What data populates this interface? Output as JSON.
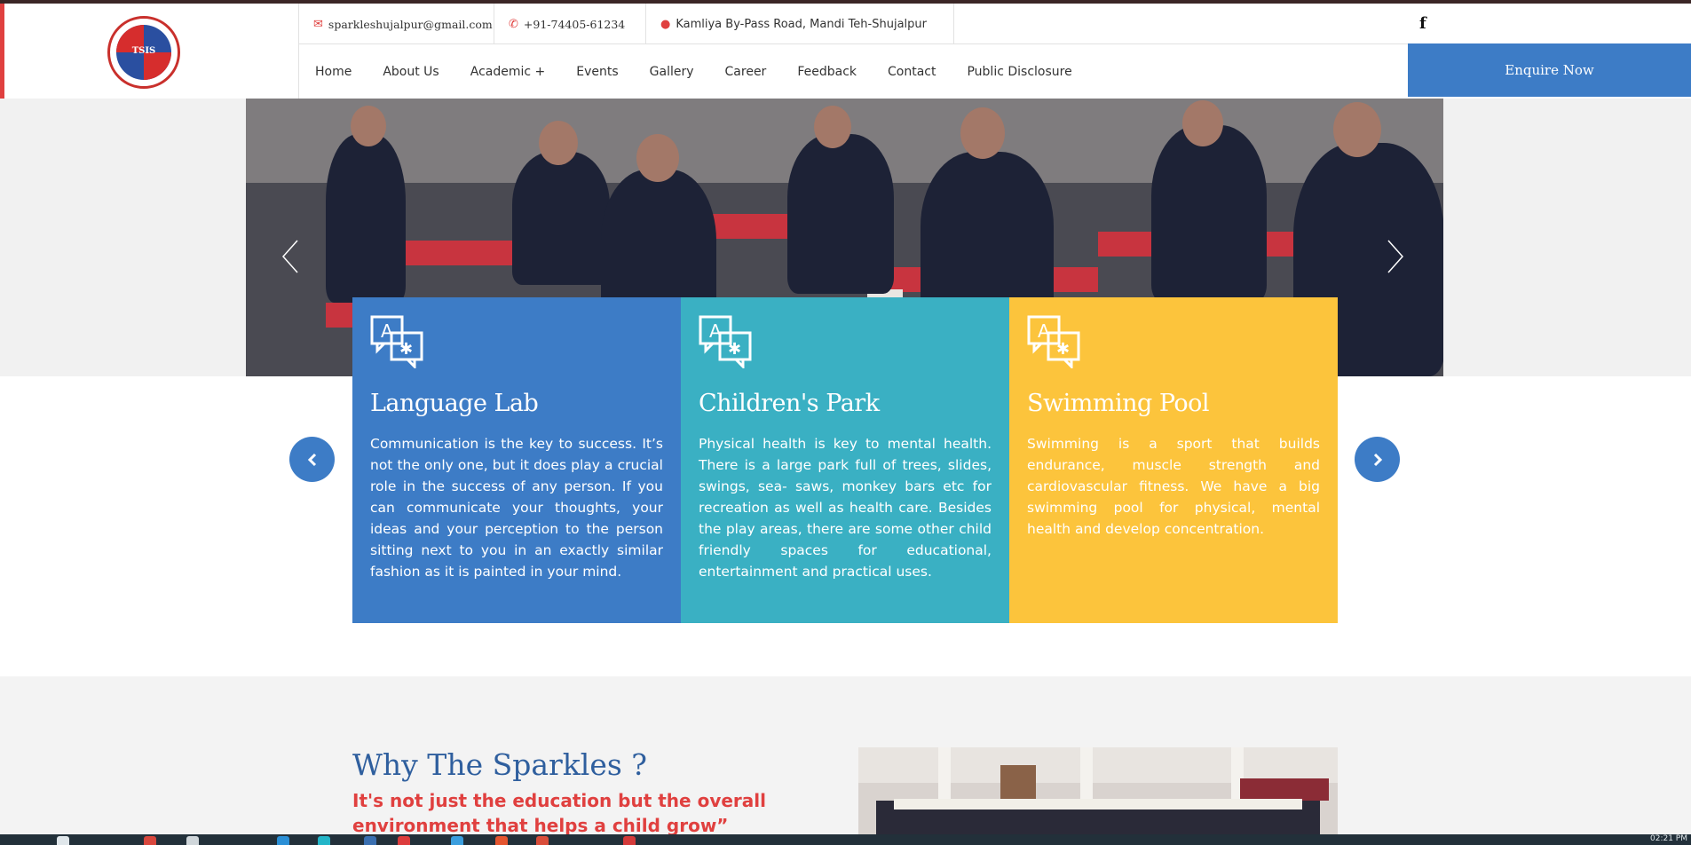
{
  "logo": {
    "text": "TSIS"
  },
  "contact": {
    "email": "sparkleshujalpur@gmail.com",
    "phone": "+91-74405-61234",
    "address": "Kamliya By-Pass Road, Mandi Teh-Shujalpur"
  },
  "social": {
    "facebook": "f"
  },
  "nav": {
    "items": [
      "Home",
      "About Us",
      "Academic +",
      "Events",
      "Gallery",
      "Career",
      "Feedback",
      "Contact",
      "Public Disclosure"
    ]
  },
  "cta": {
    "enquire": "Enquire Now"
  },
  "cards": [
    {
      "title": "Language Lab",
      "text": "Communication is the key to success. It’s not the only one, but it does play a crucial role in the success of any person. If you can communicate your thoughts, your ideas and your perception to the person sitting next to you in an exactly similar fashion as it is painted in your mind.",
      "color": "#3d7cc6"
    },
    {
      "title": "Children's Park",
      "text": "Physical health is key to mental health. There is a large park full of trees, slides, swings, sea- saws, monkey bars etc for recreation as well as health care. Besides the play areas, there are some other child friendly spaces for educational, entertainment and practical uses.",
      "color": "#3ab0c3"
    },
    {
      "title": "Swimming Pool",
      "text": "Swimming is a sport that builds endurance, muscle strength and cardiovascular fitness. We have a big swimming pool for physical, mental health and develop concentration.",
      "color": "#fcc43c"
    }
  ],
  "why": {
    "title": "Why The Sparkles ?",
    "subtitle": "It's not just the education but the overall environment that helps a child grow”"
  },
  "taskbar": {
    "clock": "02:21 PM"
  },
  "colors": {
    "accent_red": "#e0403f",
    "brand_blue": "#3d7cc6"
  }
}
